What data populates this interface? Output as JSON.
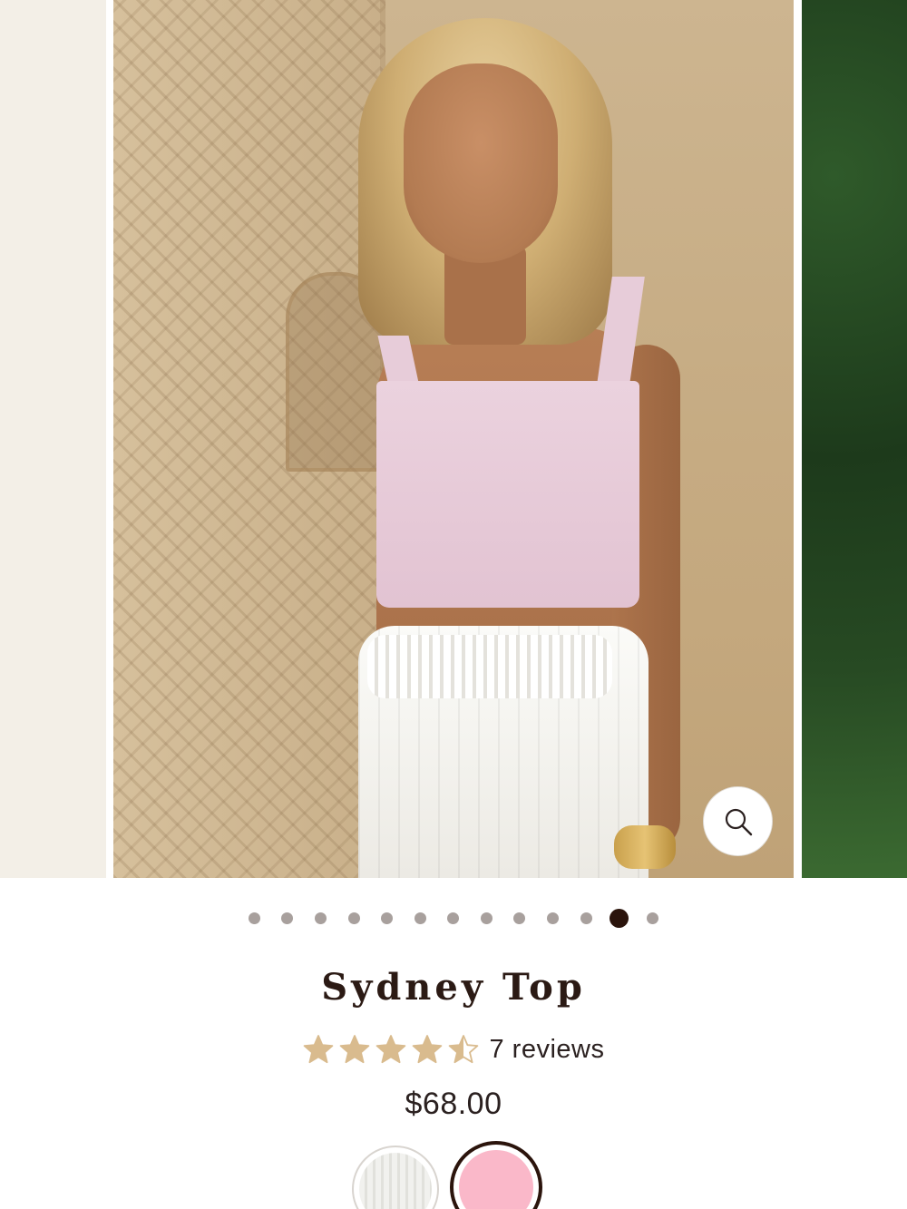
{
  "gallery": {
    "slide_count": 13,
    "active_index": 11,
    "zoom_icon": "magnifier-icon"
  },
  "product": {
    "title": "Sydney Top",
    "rating": 4.5,
    "rating_max": 5,
    "reviews_label": "7 reviews",
    "price": "$68.00"
  },
  "swatches": [
    {
      "name": "white",
      "color": "#f1f1ee",
      "selected": false
    },
    {
      "name": "pink",
      "color": "#fab8c9",
      "selected": true
    }
  ],
  "colors": {
    "star": "#d9bb8e",
    "text": "#2b2120",
    "active_dot": "#2b140c",
    "inactive_dot": "#a8a09d"
  }
}
